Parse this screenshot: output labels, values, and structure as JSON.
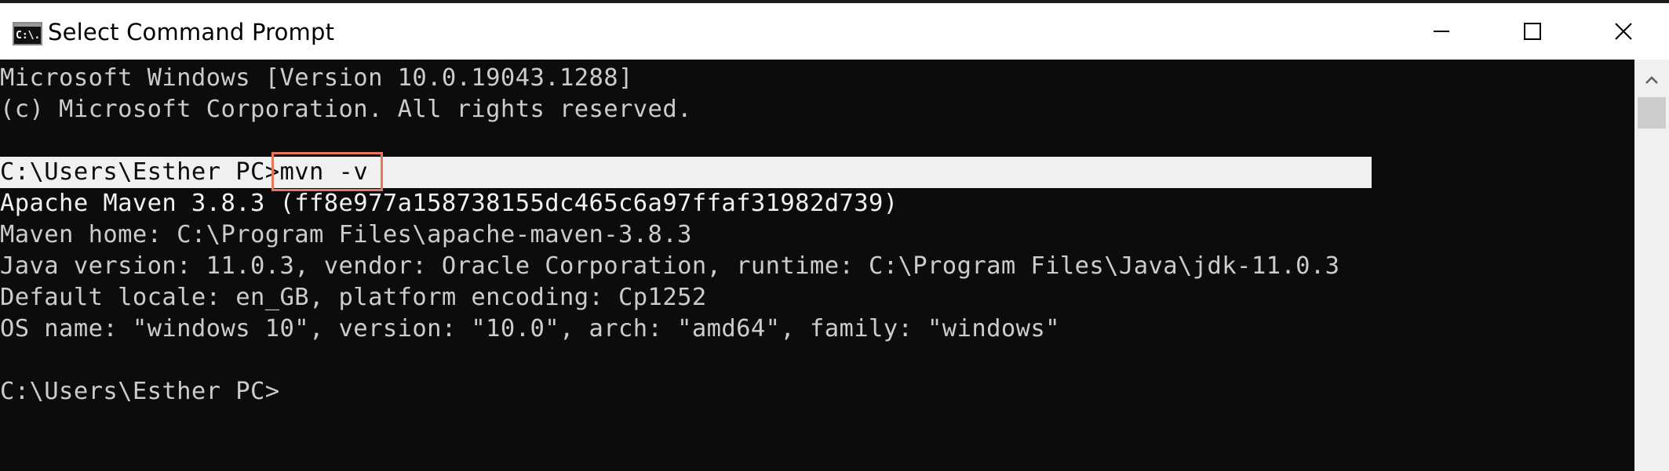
{
  "window": {
    "title": "Select Command Prompt",
    "icon_label": "C:\\."
  },
  "console": {
    "lines": [
      "Microsoft Windows [Version 10.0.19043.1288]",
      "(c) Microsoft Corporation. All rights reserved.",
      "",
      "",
      "Apache Maven 3.8.3 (ff8e977a158738155dc465c6a97ffaf31982d739)",
      "Maven home: C:\\Program Files\\apache-maven-3.8.3",
      "Java version: 11.0.3, vendor: Oracle Corporation, runtime: C:\\Program Files\\Java\\jdk-11.0.3",
      "Default locale: en_GB, platform encoding: Cp1252",
      "OS name: \"windows 10\", version: \"10.0\", arch: \"amd64\", family: \"windows\"",
      "",
      "C:\\Users\\Esther PC>"
    ],
    "command_prompt": "C:\\Users\\Esther PC>",
    "command_text": "mvn -v"
  },
  "colors": {
    "console_bg": "#0c0c0c",
    "console_text": "#cccccc",
    "highlight_border": "#e8765a",
    "selection_bg": "#f0f0f0"
  },
  "icons": {
    "minimize": "minimize-icon",
    "maximize": "maximize-icon",
    "close": "close-icon",
    "scroll_up": "chevron-up-icon",
    "app": "command-prompt-icon"
  }
}
